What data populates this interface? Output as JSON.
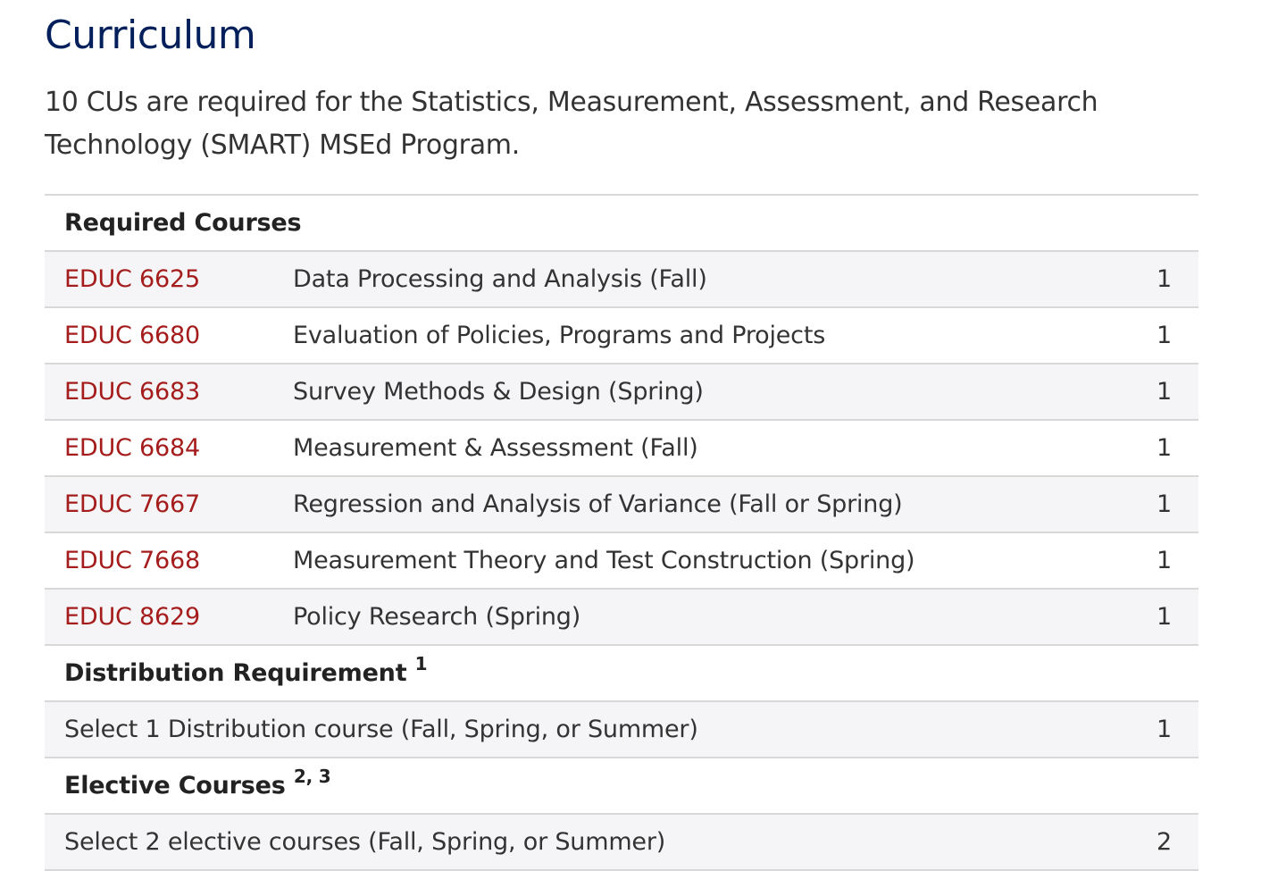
{
  "heading": "Curriculum",
  "intro": "10 CUs are required for the Statistics, Measurement, Assessment, and Research Technology (SMART) MSEd Program.",
  "sections": {
    "required": {
      "label": "Required Courses",
      "courses": [
        {
          "code": "EDUC 6625",
          "title": "Data Processing and Analysis (Fall)",
          "cu": "1"
        },
        {
          "code": "EDUC 6680",
          "title": "Evaluation of Policies, Programs and Projects",
          "cu": "1"
        },
        {
          "code": "EDUC 6683",
          "title": "Survey Methods & Design (Spring)",
          "cu": "1"
        },
        {
          "code": "EDUC 6684",
          "title": "Measurement & Assessment (Fall)",
          "cu": "1"
        },
        {
          "code": "EDUC 7667",
          "title": "Regression and Analysis of Variance (Fall or Spring)",
          "cu": "1"
        },
        {
          "code": "EDUC 7668",
          "title": "Measurement Theory and Test Construction (Spring)",
          "cu": "1"
        },
        {
          "code": "EDUC 8629",
          "title": "Policy Research (Spring)",
          "cu": "1"
        }
      ]
    },
    "distribution": {
      "label": "Distribution Requirement",
      "footnote": "1",
      "select_text": "Select 1 Distribution course (Fall, Spring, or Summer)",
      "cu": "1"
    },
    "elective": {
      "label": "Elective Courses",
      "footnote": "2, 3",
      "select_text": "Select 2 elective courses (Fall, Spring, or Summer)",
      "cu": "2"
    }
  }
}
